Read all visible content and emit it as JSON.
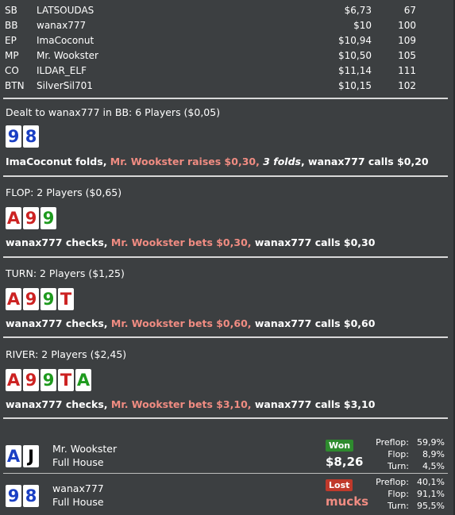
{
  "colors": {
    "background": "#3c3f41",
    "aggressive_action": "#f08c82",
    "won_badge": "#2e8b2e",
    "lost_badge": "#c0392b",
    "suit_spades": "#000000",
    "suit_hearts": "#cc2222",
    "suit_diamonds": "#1a3fc4",
    "suit_clubs": "#1e9a1e"
  },
  "seats": [
    {
      "pos": "SB",
      "name": "LATSOUDAS",
      "stack": "$6,73",
      "bb": "67"
    },
    {
      "pos": "BB",
      "name": "wanax777",
      "stack": "$10",
      "bb": "100"
    },
    {
      "pos": "EP",
      "name": "ImaCoconut",
      "stack": "$10,94",
      "bb": "109"
    },
    {
      "pos": "MP",
      "name": "Mr. Wookster",
      "stack": "$10,50",
      "bb": "105"
    },
    {
      "pos": "CO",
      "name": "ILDAR_ELF",
      "stack": "$11,14",
      "bb": "111"
    },
    {
      "pos": "BTN",
      "name": "SilverSil701",
      "stack": "$10,15",
      "bb": "102"
    }
  ],
  "preflop": {
    "title": "Dealt to wanax777 in BB: 6 Players ($0,05)",
    "cards": [
      {
        "rank": "9",
        "suit": "diamonds"
      },
      {
        "rank": "8",
        "suit": "diamonds"
      }
    ],
    "actions": {
      "a1": "ImaCoconut folds, ",
      "a2": "Mr. Wookster raises $0,30, ",
      "a3": "3 folds",
      "a4": ", wanax777 calls $0,20"
    }
  },
  "flop": {
    "title": "FLOP: 2 Players ($0,65)",
    "cards": [
      {
        "rank": "A",
        "suit": "hearts"
      },
      {
        "rank": "9",
        "suit": "hearts"
      },
      {
        "rank": "9",
        "suit": "clubs"
      }
    ],
    "actions": {
      "a1": "wanax777 checks, ",
      "a2": "Mr. Wookster bets $0,30, ",
      "a3": "wanax777 calls $0,30"
    }
  },
  "turn": {
    "title": "TURN: 2 Players ($1,25)",
    "cards": [
      {
        "rank": "A",
        "suit": "hearts"
      },
      {
        "rank": "9",
        "suit": "hearts"
      },
      {
        "rank": "9",
        "suit": "clubs"
      },
      {
        "rank": "T",
        "suit": "hearts"
      }
    ],
    "actions": {
      "a1": "wanax777 checks, ",
      "a2": "Mr. Wookster bets $0,60, ",
      "a3": "wanax777 calls $0,60"
    }
  },
  "river": {
    "title": "RIVER: 2 Players ($2,45)",
    "cards": [
      {
        "rank": "A",
        "suit": "hearts"
      },
      {
        "rank": "9",
        "suit": "hearts"
      },
      {
        "rank": "9",
        "suit": "clubs"
      },
      {
        "rank": "T",
        "suit": "hearts"
      },
      {
        "rank": "A",
        "suit": "clubs"
      }
    ],
    "actions": {
      "a1": "wanax777 checks, ",
      "a2": "Mr. Wookster bets $3,10, ",
      "a3": "wanax777 calls $3,10"
    }
  },
  "results": [
    {
      "name": "Mr. Wookster",
      "hand": "Full House",
      "badge": "Won",
      "amount": "$8,26",
      "cards": [
        {
          "rank": "A",
          "suit": "diamonds"
        },
        {
          "rank": "J",
          "suit": "spades"
        }
      ],
      "equity": [
        {
          "label": "Preflop:",
          "value": "59,9%"
        },
        {
          "label": "Flop:",
          "value": "8,9%"
        },
        {
          "label": "Turn:",
          "value": "4,5%"
        }
      ]
    },
    {
      "name": "wanax777",
      "hand": "Full House",
      "badge": "Lost",
      "amount": "mucks",
      "cards": [
        {
          "rank": "9",
          "suit": "diamonds"
        },
        {
          "rank": "8",
          "suit": "diamonds"
        }
      ],
      "equity": [
        {
          "label": "Preflop:",
          "value": "40,1%"
        },
        {
          "label": "Flop:",
          "value": "91,1%"
        },
        {
          "label": "Turn:",
          "value": "95,5%"
        }
      ]
    }
  ]
}
